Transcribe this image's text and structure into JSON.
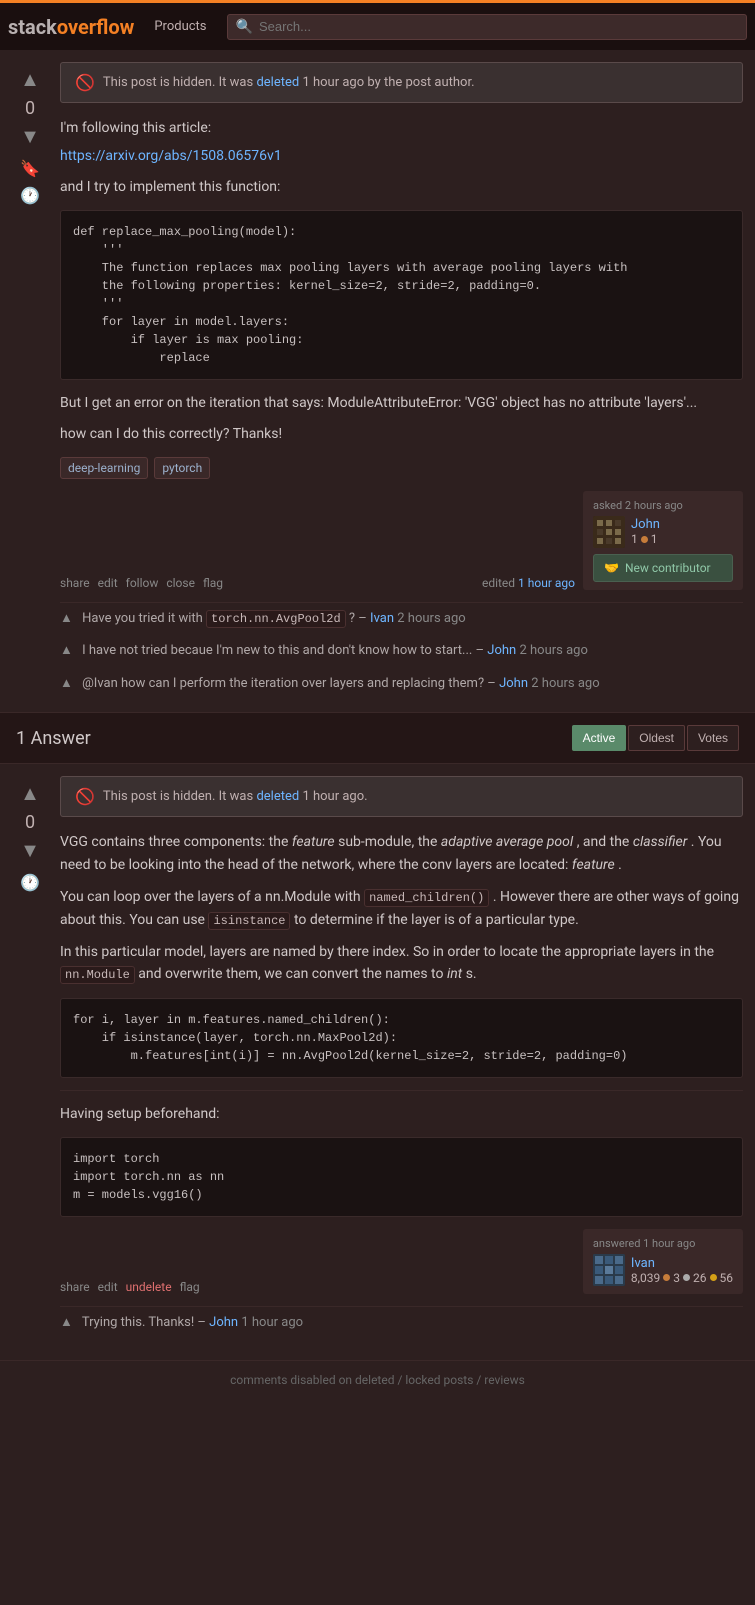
{
  "navbar": {
    "logo_stack": "stack",
    "logo_overflow": "overflow",
    "products_label": "Products",
    "search_placeholder": "Search..."
  },
  "question": {
    "vote_count": "0",
    "hidden_notice": "This post is hidden. It was",
    "hidden_link_text": "deleted",
    "hidden_time": "1 hour ago by the post author.",
    "body_1": "I'm following this article:",
    "article_link": "https://arxiv.org/abs/1508.06576v1",
    "body_2": "and I try to implement this function:",
    "code": "def replace_max_pooling(model):\n    '''\n    The function replaces max pooling layers with average pooling layers with\n    the following properties: kernel_size=2, stride=2, padding=0.\n    '''\n    for layer in model.layers:\n        if layer is max pooling:\n            replace",
    "body_3": "But I get an error on the iteration that says: ModuleAttributeError: 'VGG' object has no attribute 'layers'...",
    "body_4": "how can I do this correctly? Thanks!",
    "tags": [
      "deep-learning",
      "pytorch"
    ],
    "actions": {
      "share": "share",
      "edit": "edit",
      "follow": "follow",
      "close": "close",
      "flag": "flag"
    },
    "edited_label": "edited",
    "edited_time": "1 hour ago",
    "asked_label": "asked",
    "asked_time": "2 hours ago",
    "user": {
      "name": "John",
      "rep": "1",
      "bronze": "1"
    },
    "new_contributor_label": "New contributor",
    "comments": [
      {
        "text": "Have you tried it with",
        "code": "torch.nn.AvgPool2d",
        "text2": "? –",
        "user": "Ivan",
        "time": "2 hours ago"
      },
      {
        "text": "I have not tried becaue I'm new to this and don't know how to start... –",
        "user": "John",
        "time": "2 hours ago"
      },
      {
        "text": "@Ivan how can I perform the iteration over layers and replacing them? –",
        "user": "John",
        "time": "2 hours ago"
      }
    ]
  },
  "answers_section": {
    "count_label": "1 Answer",
    "sort_buttons": [
      "Active",
      "Oldest",
      "Votes"
    ],
    "active_sort": "Active"
  },
  "answer": {
    "vote_count": "0",
    "hidden_notice": "This post is hidden. It was",
    "hidden_link_text": "deleted",
    "hidden_time": "1 hour ago.",
    "body_1": "VGG contains three components: the",
    "italic_1": "feature",
    "body_2": "sub-module, the",
    "italic_2": "adaptive average pool",
    "body_3": ", and the",
    "italic_3": "classifier",
    "body_4": ". You need to be looking into the head of the network, where the conv layers are located:",
    "italic_4": "feature",
    "body_5": ".",
    "body_6": "You can loop over the layers of a nn.Module with",
    "code_1": "named_children()",
    "body_7": ". However there are other ways of going about this. You can use",
    "code_2": "isinstance",
    "body_8": "to determine if the layer is of a particular type.",
    "body_9": "In this particular model, layers are named by there index. So in order to locate the appropriate layers in the",
    "code_3": "nn.Module",
    "body_10": "and overwrite them, we can convert the names to",
    "italic_5": "int",
    "body_11": "s.",
    "code_block_1": "for i, layer in m.features.named_children():\n    if isinstance(layer, torch.nn.MaxPool2d):\n        m.features[int(i)] = nn.AvgPool2d(kernel_size=2, stride=2, padding=0)",
    "having_setup": "Having setup beforehand:",
    "code_block_2": "import torch\nimport torch.nn as nn\nm = models.vgg16()",
    "actions": {
      "share": "share",
      "edit": "edit",
      "undelete": "undelete",
      "flag": "flag"
    },
    "answered_label": "answered",
    "answered_time": "1 hour ago",
    "user": {
      "name": "Ivan",
      "rep": "8,039",
      "bronze_count": "3",
      "silver_count": "26",
      "gold_count": "56"
    },
    "comment": {
      "text": "Trying this. Thanks! –",
      "user": "John",
      "time": "1 hour ago"
    }
  },
  "bottom_notice": "comments disabled on deleted / locked posts / reviews"
}
